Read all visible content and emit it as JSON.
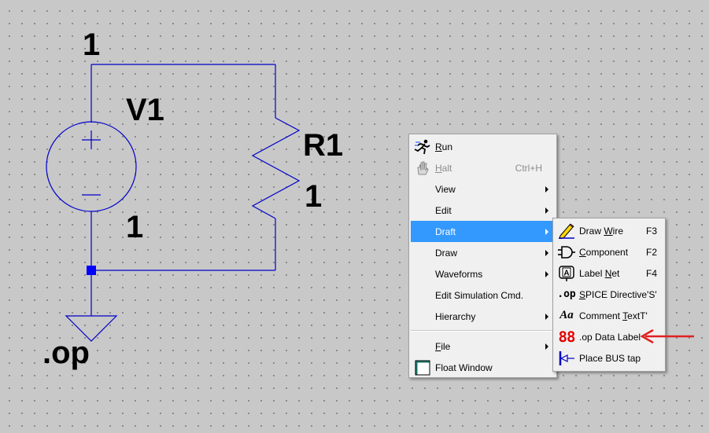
{
  "schematic": {
    "net_top": "1",
    "v1_name": "V1",
    "v1_value": "1",
    "r1_name": "R1",
    "r1_value": "1",
    "directive": ".op",
    "wire_color": "#0000c8"
  },
  "main_menu": {
    "run": {
      "u": "R",
      "rest": "un",
      "icon": "run-icon"
    },
    "halt": {
      "u": "H",
      "rest": "alt",
      "shortcut": "Ctrl+H",
      "icon": "halt-hand-icon"
    },
    "view": {
      "label": "View"
    },
    "edit": {
      "label": "Edit"
    },
    "draft": {
      "label": "Draft"
    },
    "draw": {
      "label": "Draw"
    },
    "waveforms": {
      "label": "Waveforms"
    },
    "edit_sim": {
      "label": "Edit Simulation Cmd."
    },
    "hierarchy": {
      "label": "Hierarchy"
    },
    "file": {
      "u": "F",
      "rest": "ile"
    },
    "float_window": {
      "label": "Float Window",
      "icon": "float-window-icon"
    }
  },
  "draft_menu": {
    "draw_wire": {
      "pre": "Draw ",
      "u": "W",
      "rest": "ire",
      "shortcut": "F3",
      "icon": "pencil-icon"
    },
    "component": {
      "u": "C",
      "rest": "omponent",
      "shortcut": "F2",
      "icon": "and-gate-icon"
    },
    "label_net": {
      "pre": "Label ",
      "u": "N",
      "rest": "et",
      "shortcut": "F4",
      "icon": "label-a-icon"
    },
    "spice": {
      "u": "S",
      "rest": "PICE Directive'S'",
      "icon_text": ".op"
    },
    "comment": {
      "pre": "Comment ",
      "u": "T",
      "rest": "extT'",
      "icon_text": "Aa"
    },
    "op_label": {
      "label": ".op Data Label",
      "icon_text": "88"
    },
    "bus_tap": {
      "label": "Place BUS tap",
      "icon": "bus-tap-icon"
    }
  },
  "colors": {
    "highlight": "#3399ff",
    "annotation_arrow": "#e02020",
    "op_digits": "#e00000"
  }
}
